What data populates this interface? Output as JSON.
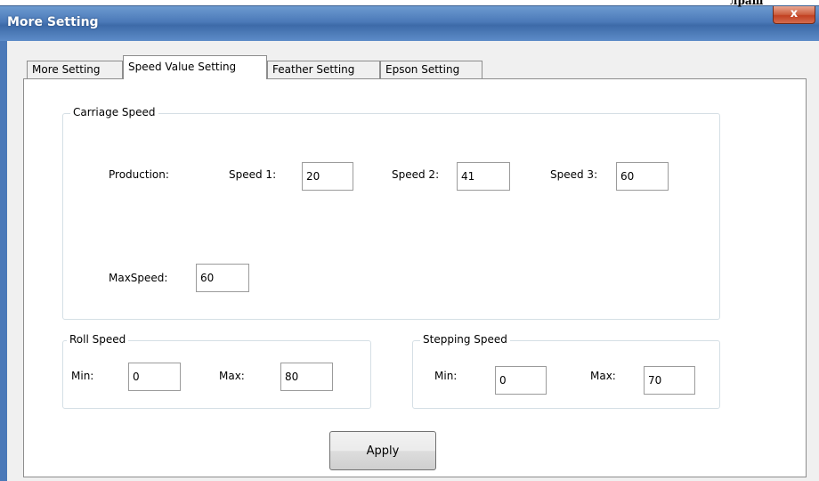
{
  "window": {
    "title": "More Setting",
    "close_label": "x",
    "topright_text": "лраш"
  },
  "tabs": [
    {
      "label": "More Setting",
      "active": false
    },
    {
      "label": "Speed Value Setting",
      "active": true
    },
    {
      "label": "Feather Setting",
      "active": false
    },
    {
      "label": "Epson Setting",
      "active": false
    }
  ],
  "carriage": {
    "title": "Carriage Speed",
    "production_label": "Production:",
    "speed1_label": "Speed 1:",
    "speed1_value": "20",
    "speed2_label": "Speed 2:",
    "speed2_value": "41",
    "speed3_label": "Speed 3:",
    "speed3_value": "60",
    "maxspeed_label": "MaxSpeed:",
    "maxspeed_value": "60"
  },
  "roll": {
    "title": "Roll Speed",
    "min_label": "Min:",
    "min_value": "0",
    "max_label": "Max:",
    "max_value": "80"
  },
  "stepping": {
    "title": "Stepping Speed",
    "min_label": "Min:",
    "min_value": "0",
    "max_label": "Max:",
    "max_value": "70"
  },
  "apply_label": "Apply"
}
